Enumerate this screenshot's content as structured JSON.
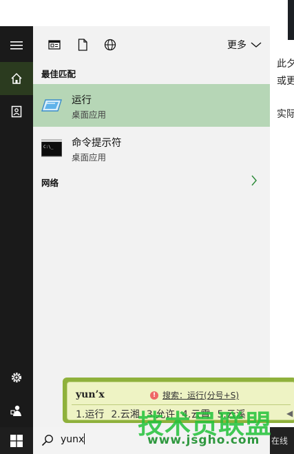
{
  "document": {
    "lines": [
      "此夕",
      "或更",
      "实际"
    ]
  },
  "rail": {
    "items": [
      {
        "name": "hamburger-icon"
      },
      {
        "name": "home-icon"
      },
      {
        "name": "documents-icon"
      },
      {
        "name": "settings-icon"
      },
      {
        "name": "feedback-icon"
      }
    ]
  },
  "filters": {
    "icons": [
      "apps-filter-icon",
      "documents-filter-icon",
      "web-filter-icon"
    ],
    "more_label": "更多"
  },
  "results": {
    "best_match_heading": "最佳匹配",
    "items": [
      {
        "title": "运行",
        "subtitle": "桌面应用",
        "icon": "run-app-icon",
        "selected": true
      },
      {
        "title": "命令提示符",
        "subtitle": "桌面应用",
        "icon": "command-prompt-icon",
        "selected": false
      }
    ],
    "network_heading": "网络"
  },
  "taskbar": {
    "search_value": "yunx",
    "tray_text": "在线"
  },
  "ime": {
    "pinyin": "yun’x",
    "hint": "搜索：运行(分号+S)",
    "candidates": [
      "1.运行",
      "2.云湘",
      "3.允许",
      "4.云霄",
      "5.云溪"
    ]
  },
  "watermark": {
    "text": "技术员联盟",
    "url": "www.jsgho.com"
  },
  "colors": {
    "accent_selected": "#b6d6b6",
    "rail": "#1a1a1a",
    "ime_border": "#8fb13c",
    "watermark": "#22c23a"
  }
}
